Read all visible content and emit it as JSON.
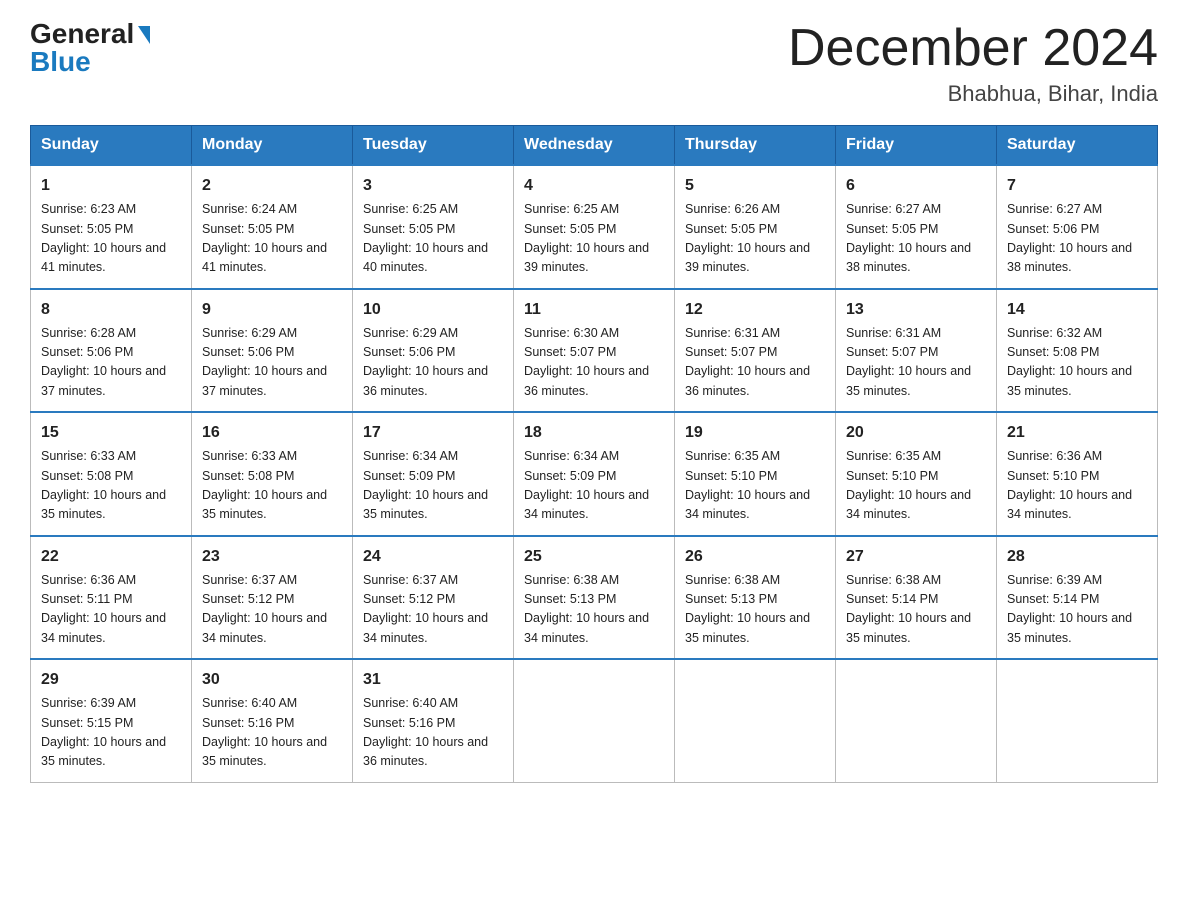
{
  "header": {
    "logo_general": "General",
    "logo_blue": "Blue",
    "main_title": "December 2024",
    "subtitle": "Bhabhua, Bihar, India"
  },
  "days_of_week": [
    "Sunday",
    "Monday",
    "Tuesday",
    "Wednesday",
    "Thursday",
    "Friday",
    "Saturday"
  ],
  "weeks": [
    [
      {
        "day": "1",
        "sunrise": "6:23 AM",
        "sunset": "5:05 PM",
        "daylight": "10 hours and 41 minutes."
      },
      {
        "day": "2",
        "sunrise": "6:24 AM",
        "sunset": "5:05 PM",
        "daylight": "10 hours and 41 minutes."
      },
      {
        "day": "3",
        "sunrise": "6:25 AM",
        "sunset": "5:05 PM",
        "daylight": "10 hours and 40 minutes."
      },
      {
        "day": "4",
        "sunrise": "6:25 AM",
        "sunset": "5:05 PM",
        "daylight": "10 hours and 39 minutes."
      },
      {
        "day": "5",
        "sunrise": "6:26 AM",
        "sunset": "5:05 PM",
        "daylight": "10 hours and 39 minutes."
      },
      {
        "day": "6",
        "sunrise": "6:27 AM",
        "sunset": "5:05 PM",
        "daylight": "10 hours and 38 minutes."
      },
      {
        "day": "7",
        "sunrise": "6:27 AM",
        "sunset": "5:06 PM",
        "daylight": "10 hours and 38 minutes."
      }
    ],
    [
      {
        "day": "8",
        "sunrise": "6:28 AM",
        "sunset": "5:06 PM",
        "daylight": "10 hours and 37 minutes."
      },
      {
        "day": "9",
        "sunrise": "6:29 AM",
        "sunset": "5:06 PM",
        "daylight": "10 hours and 37 minutes."
      },
      {
        "day": "10",
        "sunrise": "6:29 AM",
        "sunset": "5:06 PM",
        "daylight": "10 hours and 36 minutes."
      },
      {
        "day": "11",
        "sunrise": "6:30 AM",
        "sunset": "5:07 PM",
        "daylight": "10 hours and 36 minutes."
      },
      {
        "day": "12",
        "sunrise": "6:31 AM",
        "sunset": "5:07 PM",
        "daylight": "10 hours and 36 minutes."
      },
      {
        "day": "13",
        "sunrise": "6:31 AM",
        "sunset": "5:07 PM",
        "daylight": "10 hours and 35 minutes."
      },
      {
        "day": "14",
        "sunrise": "6:32 AM",
        "sunset": "5:08 PM",
        "daylight": "10 hours and 35 minutes."
      }
    ],
    [
      {
        "day": "15",
        "sunrise": "6:33 AM",
        "sunset": "5:08 PM",
        "daylight": "10 hours and 35 minutes."
      },
      {
        "day": "16",
        "sunrise": "6:33 AM",
        "sunset": "5:08 PM",
        "daylight": "10 hours and 35 minutes."
      },
      {
        "day": "17",
        "sunrise": "6:34 AM",
        "sunset": "5:09 PM",
        "daylight": "10 hours and 35 minutes."
      },
      {
        "day": "18",
        "sunrise": "6:34 AM",
        "sunset": "5:09 PM",
        "daylight": "10 hours and 34 minutes."
      },
      {
        "day": "19",
        "sunrise": "6:35 AM",
        "sunset": "5:10 PM",
        "daylight": "10 hours and 34 minutes."
      },
      {
        "day": "20",
        "sunrise": "6:35 AM",
        "sunset": "5:10 PM",
        "daylight": "10 hours and 34 minutes."
      },
      {
        "day": "21",
        "sunrise": "6:36 AM",
        "sunset": "5:10 PM",
        "daylight": "10 hours and 34 minutes."
      }
    ],
    [
      {
        "day": "22",
        "sunrise": "6:36 AM",
        "sunset": "5:11 PM",
        "daylight": "10 hours and 34 minutes."
      },
      {
        "day": "23",
        "sunrise": "6:37 AM",
        "sunset": "5:12 PM",
        "daylight": "10 hours and 34 minutes."
      },
      {
        "day": "24",
        "sunrise": "6:37 AM",
        "sunset": "5:12 PM",
        "daylight": "10 hours and 34 minutes."
      },
      {
        "day": "25",
        "sunrise": "6:38 AM",
        "sunset": "5:13 PM",
        "daylight": "10 hours and 34 minutes."
      },
      {
        "day": "26",
        "sunrise": "6:38 AM",
        "sunset": "5:13 PM",
        "daylight": "10 hours and 35 minutes."
      },
      {
        "day": "27",
        "sunrise": "6:38 AM",
        "sunset": "5:14 PM",
        "daylight": "10 hours and 35 minutes."
      },
      {
        "day": "28",
        "sunrise": "6:39 AM",
        "sunset": "5:14 PM",
        "daylight": "10 hours and 35 minutes."
      }
    ],
    [
      {
        "day": "29",
        "sunrise": "6:39 AM",
        "sunset": "5:15 PM",
        "daylight": "10 hours and 35 minutes."
      },
      {
        "day": "30",
        "sunrise": "6:40 AM",
        "sunset": "5:16 PM",
        "daylight": "10 hours and 35 minutes."
      },
      {
        "day": "31",
        "sunrise": "6:40 AM",
        "sunset": "5:16 PM",
        "daylight": "10 hours and 36 minutes."
      },
      null,
      null,
      null,
      null
    ]
  ]
}
